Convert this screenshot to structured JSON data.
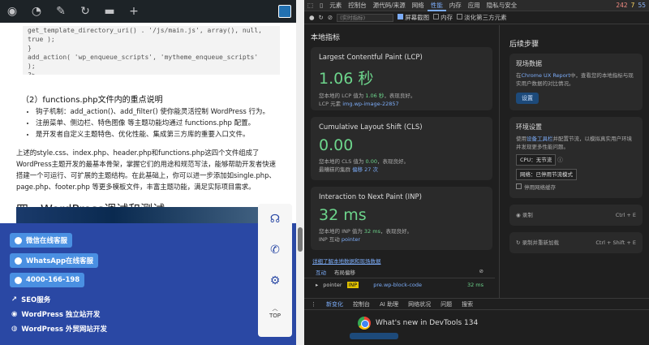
{
  "wp_toolbar": {
    "icons": [
      "wordpress-icon",
      "dashboard-icon",
      "brush-icon",
      "refresh-icon",
      "comment-icon",
      "plus-icon"
    ]
  },
  "code": {
    "lines": [
      "get_template_directory_uri() . '/js/main.js', array(), null,",
      "true );",
      "}",
      "add_action( 'wp_enqueue_scripts', 'mytheme_enqueue_scripts'",
      ");",
      "?>"
    ]
  },
  "article": {
    "section_title": "（2）functions.php文件内的重点说明",
    "bullets": [
      "钩子机制：add_action()、add_filter() 使你能灵活控制 WordPress 行为。",
      "注册菜单、侧边栏、特色图像 等主题功能均通过 functions.php 配置。",
      "是开发者自定义主题特色、优化性能、集成第三方库的重要入口文件。"
    ],
    "paragraph": "上述的style.css、index.php、header.php和functions.php这四个文件组成了WordPress主题开发的最基本骨架，掌握它们的用途和规范写法，能够帮助开发者快速搭建一个可运行、可扩展的主题结构。在此基础上，你可以进一步添加如single.php、page.php、footer.php 等更多模板文件，丰富主题功能，满足实际项目需求。",
    "heading": "四、WordPress调试和测试"
  },
  "contact": {
    "wechat": "微信在线客服",
    "whatsapp": "WhatsApp在线客服",
    "phone": "4000-166-198",
    "links": [
      "SEO服务",
      "WordPress 独立站开发",
      "WordPress 外贸网站开发"
    ]
  },
  "float_top": "TOP",
  "devtools": {
    "tabs": [
      "元素",
      "控制台",
      "源代码/来源",
      "网络",
      "性能",
      "内存",
      "应用",
      "隐私与安全"
    ],
    "active_tab": "性能",
    "status": {
      "errors": "242",
      "warnings": "7",
      "info": "55"
    },
    "toolbar": {
      "select_placeholder": "(实时指标)",
      "screenshots": "屏幕截图",
      "memory": "内存",
      "third_party": "淡化第三方元素"
    },
    "local_title": "本地指标",
    "lcp": {
      "title": "Largest Contentful Paint (LCP)",
      "value": "1.06 秒",
      "desc1": "您本地的 LCP 值为",
      "val": "1.06 秒",
      "desc2": "，表现良好。",
      "el_label": "LCP 元素",
      "el": "img.wp-image-22857"
    },
    "cls": {
      "title": "Cumulative Layout Shift (CLS)",
      "value": "0.00",
      "desc1": "您本地的 CLS 值为",
      "val": "0.00",
      "desc2": "，表现良好。",
      "cluster_label": "最糟糕的集群",
      "cluster": "偏移 27 次"
    },
    "inp": {
      "title": "Interaction to Next Paint (INP)",
      "value": "32 ms",
      "desc1": "您本地的 INP 值为",
      "val": "32 ms",
      "desc2": "，表现良好。",
      "int_label": "INP 互动",
      "int": "pointer"
    },
    "learn": "详细了解本地数据和现场数据",
    "interactions": {
      "tab1": "互动",
      "tab2": "布局偏移",
      "row_type": "pointer",
      "row_tag": "INP",
      "row_el": "pre.wp-block-code",
      "row_ms": "32 ms"
    },
    "next_title": "后续步骤",
    "field": {
      "title": "现场数据",
      "desc_pre": "在",
      "link": "Chrome UX Report",
      "desc_post": "中，查看您的本地指标与现实用户数据的对比情况。",
      "button": "设置"
    },
    "env": {
      "title": "环境设置",
      "desc_pre": "使用",
      "link": "设备工具栏",
      "desc_post": "并配置节流，以模拟真实用户环境并发现更多性能问题。",
      "cpu": "CPU：无节流",
      "net": "网络：已停用节流模式",
      "disable_cache": "停用网络缓存"
    },
    "record": {
      "label": "录制",
      "shortcut": "Ctrl + E"
    },
    "reload": {
      "label": "录制并重新加载",
      "shortcut": "Ctrl + Shift + E"
    },
    "drawer_tabs": [
      "新变化",
      "控制台",
      "AI 助理",
      "网络状况",
      "问题",
      "搜索"
    ],
    "whats_new": "What's new in DevTools 134"
  }
}
